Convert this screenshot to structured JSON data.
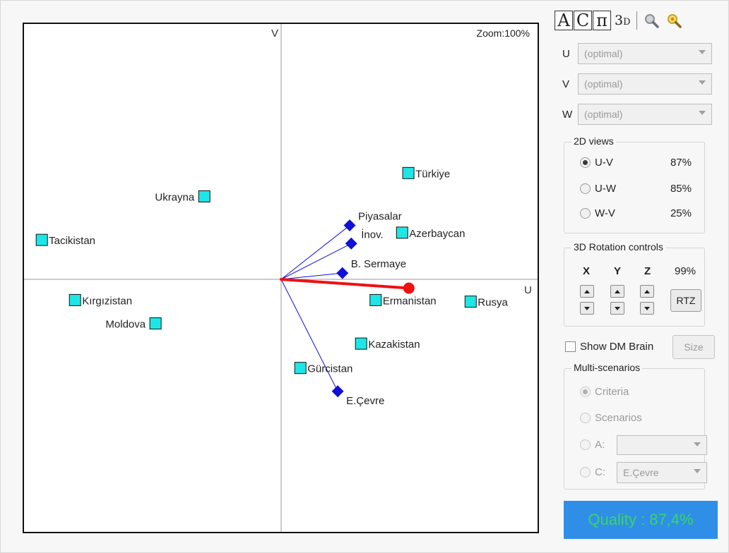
{
  "plot": {
    "zoom_label": "Zoom:100%",
    "axis_u_label": "U",
    "axis_v_label": "V",
    "colors": {
      "country": "#1ee6e6",
      "criterion": "#1010d8",
      "decision_axis": "#ee1111",
      "axis_line": "#999999"
    },
    "countries": [
      {
        "label": "Türkiye",
        "u": 0.245,
        "v": 0.205
      },
      {
        "label": "Ukrayna",
        "u": -0.148,
        "v": 0.16
      },
      {
        "label": "Tacikistan",
        "u": -0.461,
        "v": 0.076
      },
      {
        "label": "Azerbaycan",
        "u": 0.233,
        "v": 0.09
      },
      {
        "label": "Kırgızistan",
        "u": -0.397,
        "v": -0.04
      },
      {
        "label": "Moldova",
        "u": -0.242,
        "v": -0.085
      },
      {
        "label": "Ermanistan",
        "u": 0.182,
        "v": -0.04
      },
      {
        "label": "Rusya",
        "u": 0.365,
        "v": -0.043
      },
      {
        "label": "Kazakistan",
        "u": 0.154,
        "v": -0.124
      },
      {
        "label": "Gürcistan",
        "u": 0.037,
        "v": -0.171
      }
    ],
    "criteria": [
      {
        "label": "Piyasalar",
        "u": 0.132,
        "v": 0.104
      },
      {
        "label": "İnov.",
        "u": 0.135,
        "v": 0.069
      },
      {
        "label": "B. Sermaye",
        "u": 0.118,
        "v": 0.012
      },
      {
        "label": "E.Çevre",
        "u": 0.109,
        "v": -0.216
      }
    ],
    "decision_axis": {
      "u": 0.246,
      "v": -0.017
    }
  },
  "panel": {
    "toolbar": {
      "btn_a": "A",
      "btn_c": "C",
      "btn_pi": "π",
      "btn_3d": "3",
      "btn_3d_sub": "D",
      "icons": [
        "zoom-icon",
        "zoom-fit-icon"
      ]
    },
    "axis_selects": [
      {
        "label": "U",
        "value": "(optimal)"
      },
      {
        "label": "V",
        "value": "(optimal)"
      },
      {
        "label": "W",
        "value": "(optimal)"
      }
    ],
    "views": {
      "title": "2D views",
      "options": [
        {
          "label": "U-V",
          "pct": "87%",
          "selected": true
        },
        {
          "label": "U-W",
          "pct": "85%",
          "selected": false
        },
        {
          "label": "W-V",
          "pct": "25%",
          "selected": false
        }
      ]
    },
    "rotation": {
      "title": "3D Rotation controls",
      "x": "X",
      "y": "Y",
      "z": "Z",
      "pct": "99%",
      "rtz": "RTZ"
    },
    "show_brain": {
      "label": "Show DM Brain",
      "checked": false,
      "size_button": "Size"
    },
    "multi": {
      "title": "Multi-scenarios",
      "criteria": "Criteria",
      "scenarios": "Scenarios",
      "a_label": "A:",
      "a_value": "",
      "c_label": "C:",
      "c_value": "E.Çevre"
    },
    "quality": {
      "label": "Quality : 87,4%",
      "bg": "#2f8fe8",
      "fg": "#39d46a"
    }
  }
}
